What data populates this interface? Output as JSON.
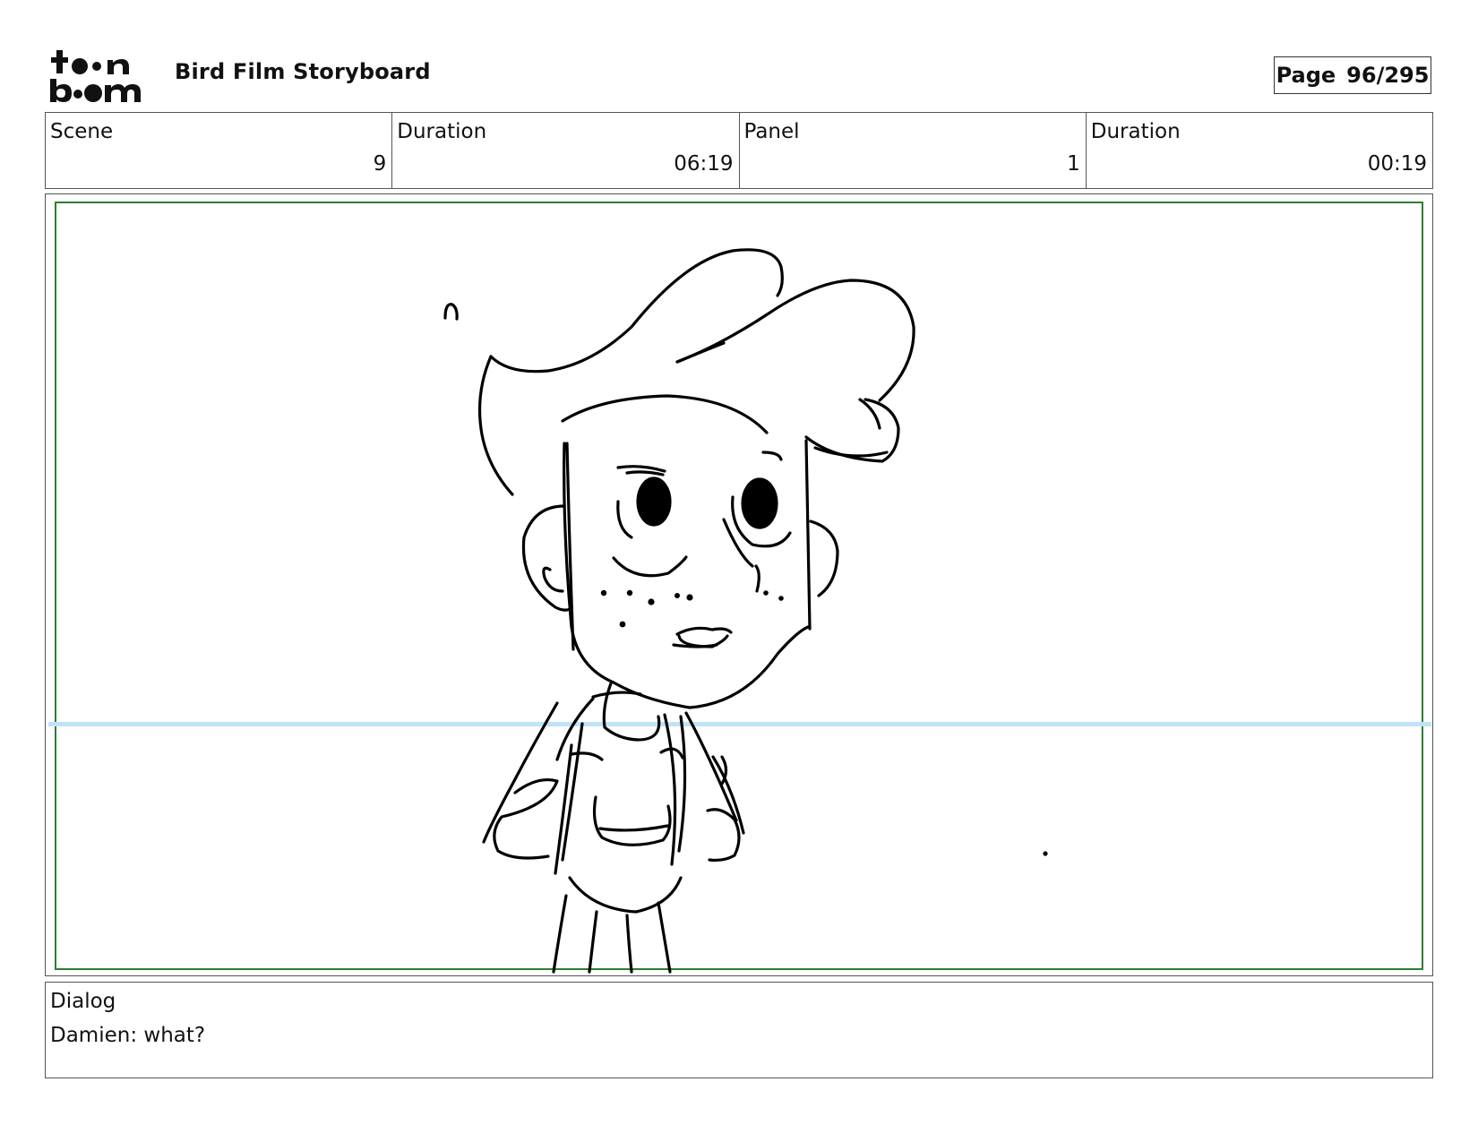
{
  "header": {
    "logo": {
      "text_top": "toon",
      "text_bottom": "boom",
      "icon": "toonboom-logo"
    },
    "title": "Bird Film Storyboard",
    "page_label": "Page",
    "page_value": "96/295"
  },
  "info": {
    "scene_label": "Scene",
    "scene_value": "9",
    "scene_duration_label": "Duration",
    "scene_duration_value": "06:19",
    "panel_label": "Panel",
    "panel_value": "1",
    "panel_duration_label": "Duration",
    "panel_duration_value": "00:19"
  },
  "panel": {
    "image": "sketch of boy with quiff hairstyle looking up, hands holding backpack straps",
    "safe_area_color": "#2e7d32",
    "horizon_color": "#bfe3f7"
  },
  "dialog": {
    "label": "Dialog",
    "text": "Damien: what?"
  }
}
